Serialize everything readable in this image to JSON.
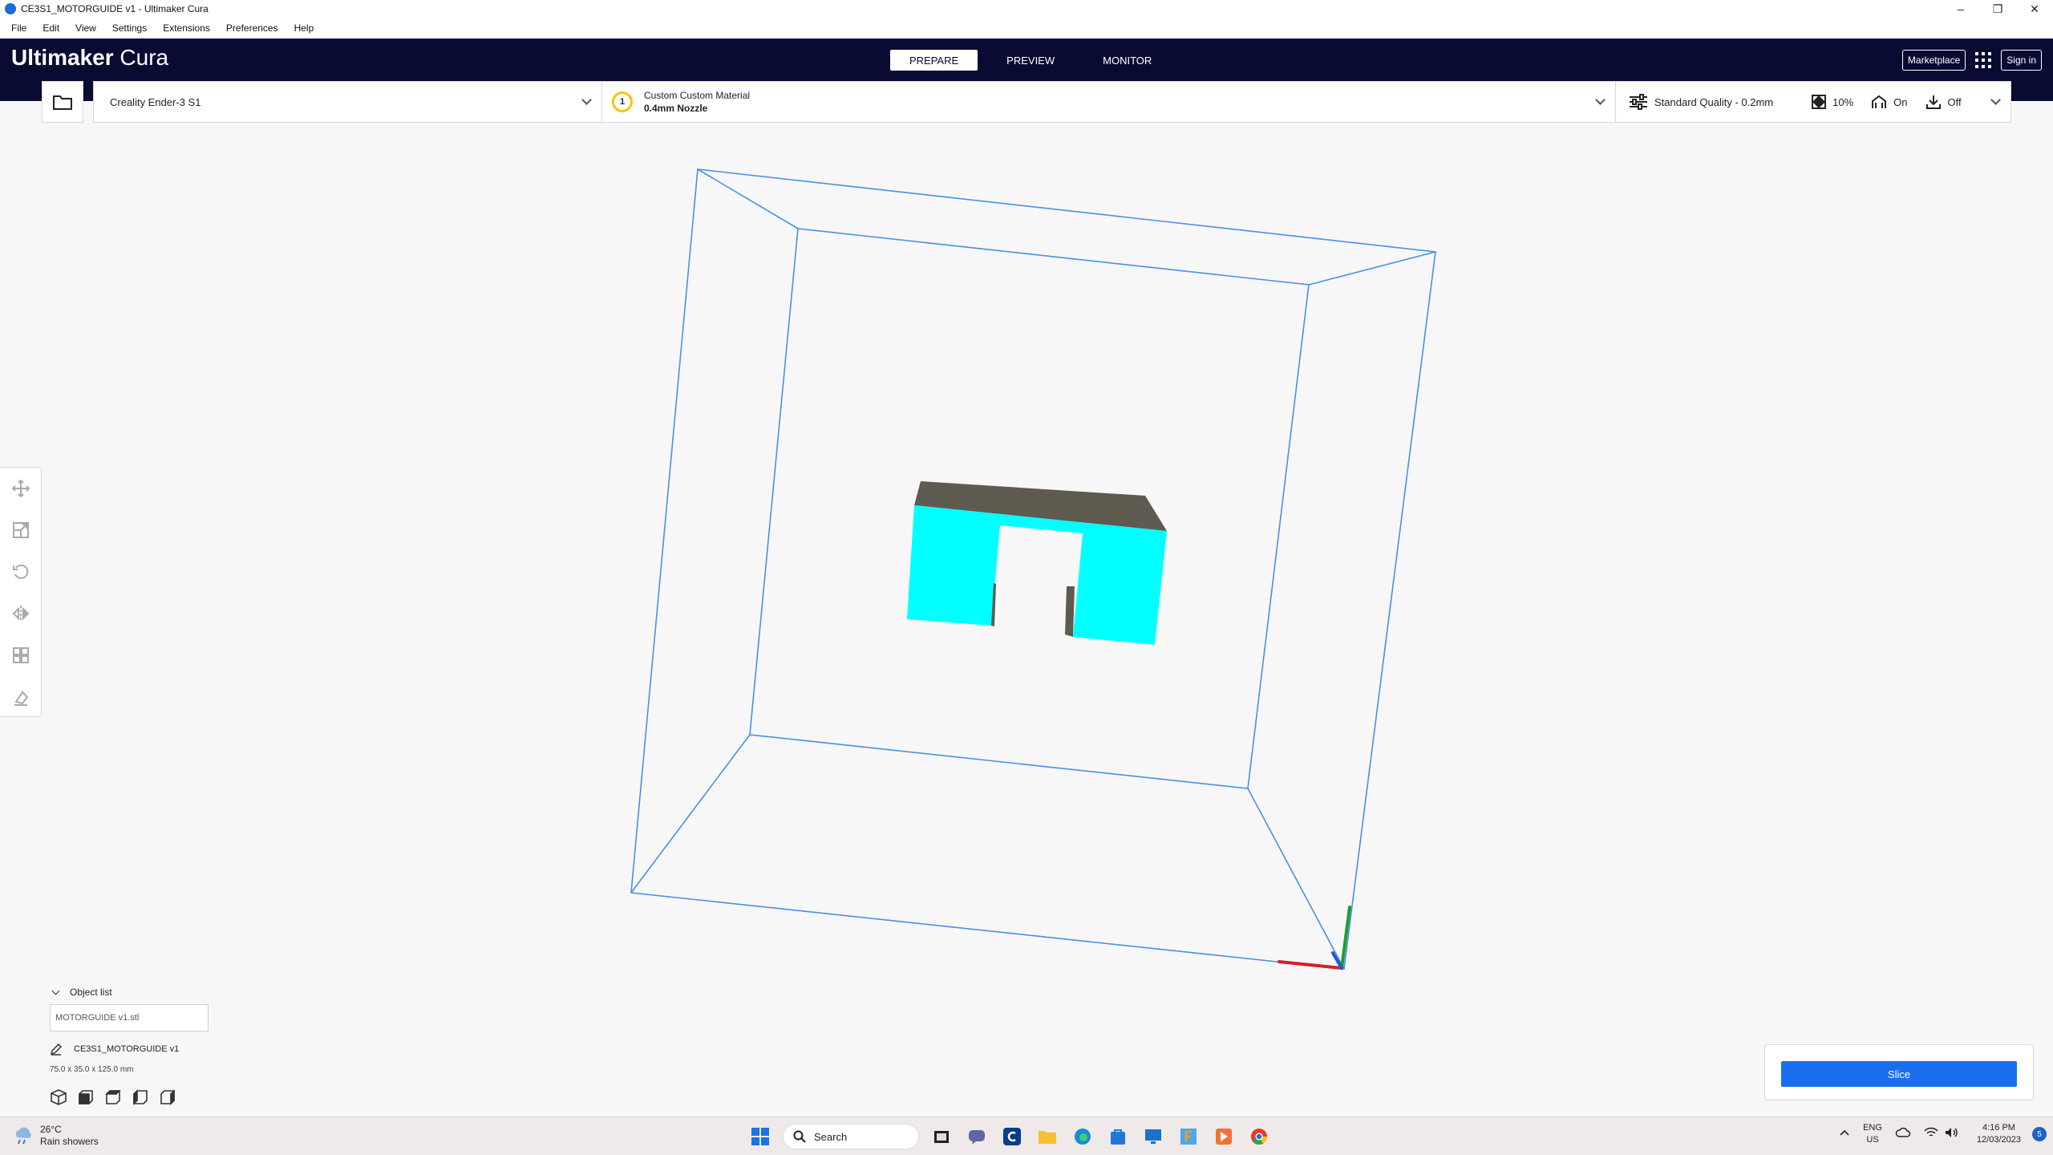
{
  "window": {
    "title": "CE3S1_MOTORGUIDE v1 - Ultimaker Cura",
    "minimize": "–",
    "restore": "❐",
    "close": "✕"
  },
  "menu": [
    "File",
    "Edit",
    "View",
    "Settings",
    "Extensions",
    "Preferences",
    "Help"
  ],
  "header": {
    "brand_bold": "Ultimaker",
    "brand_light": "Cura",
    "tabs": [
      {
        "label": "PREPARE",
        "active": true
      },
      {
        "label": "PREVIEW",
        "active": false
      },
      {
        "label": "MONITOR",
        "active": false
      }
    ],
    "marketplace": "Marketplace",
    "sign_in": "Sign in"
  },
  "printer": {
    "name": "Creality Ender-3 S1"
  },
  "material": {
    "extruder_index": "1",
    "material_name": "Custom Custom Material",
    "nozzle": "0.4mm Nozzle"
  },
  "print_settings": {
    "profile": "Standard Quality - 0.2mm",
    "infill": "10%",
    "support": "On",
    "adhesion": "Off"
  },
  "tools": [
    "move-tool",
    "scale-tool",
    "rotate-tool",
    "mirror-tool",
    "per-model-settings-tool",
    "support-blocker-tool"
  ],
  "object_list": {
    "header": "Object list",
    "file": "MOTORGUIDE v1.stl",
    "job_name": "CE3S1_MOTORGUIDE v1",
    "dimensions": "75.0 x 35.0 x 125.0 mm"
  },
  "slice": {
    "button": "Slice"
  },
  "taskbar": {
    "temperature": "26°C",
    "weather": "Rain showers",
    "search": "Search",
    "language": "ENG",
    "region": "US",
    "time": "4:16 PM",
    "date": "12/03/2023",
    "notifications": "5"
  },
  "colors": {
    "header_bg": "#0a0b33",
    "accent": "#196ef0",
    "model_front": "#00ffff",
    "model_top": "#5e5a50",
    "build_volume": "#4a90e2"
  }
}
